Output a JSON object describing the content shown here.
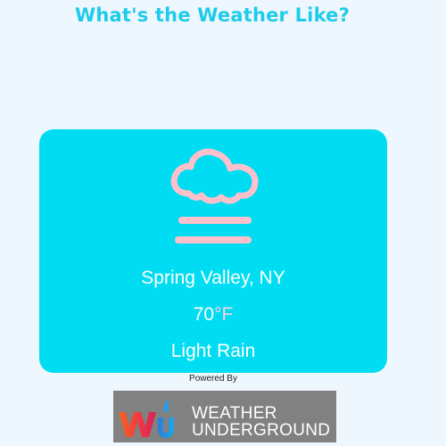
{
  "header": {
    "title": "What's the Weather Like?"
  },
  "weather": {
    "icon": "cloud-fog-icon",
    "location": "Spring Valley, NY",
    "temperature_value": "70",
    "temperature_unit": "°F",
    "condition": "Light Rain"
  },
  "footer": {
    "powered_by": "Powered By",
    "logo_text_line1": "WEATHER",
    "logo_text_line2": "UNDERGROUND",
    "logo_mark": "wu-logo-icon"
  },
  "colors": {
    "background": "#eef7fe",
    "title": "#1ecbea",
    "card": "#00ddf2",
    "icon": "#ffc0cb",
    "logo_background": "#818181"
  }
}
